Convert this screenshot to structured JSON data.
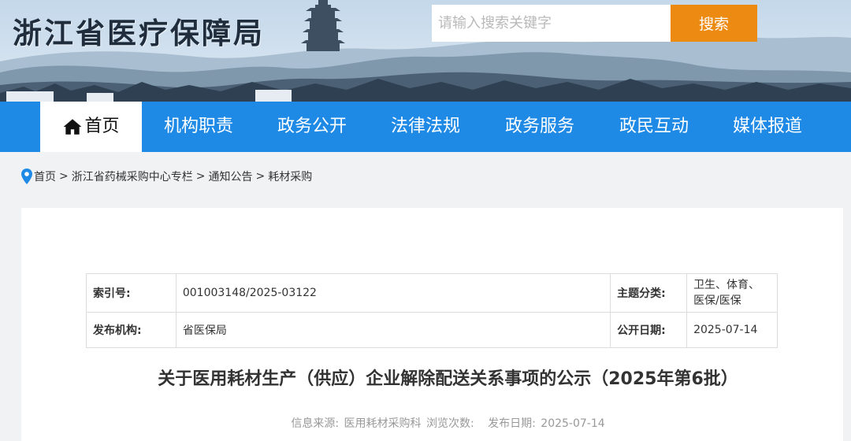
{
  "header": {
    "site_title": "浙江省医疗保障局",
    "search_placeholder": "请输入搜索关键字",
    "search_button": "搜索"
  },
  "nav": {
    "items": [
      {
        "label": "首页",
        "active": true
      },
      {
        "label": "机构职责"
      },
      {
        "label": "政务公开"
      },
      {
        "label": "法律法规"
      },
      {
        "label": "政务服务"
      },
      {
        "label": "政民互动"
      },
      {
        "label": "媒体报道"
      }
    ]
  },
  "breadcrumb": {
    "items": [
      "首页",
      "浙江省药械采购中心专栏",
      "通知公告",
      "耗材采购"
    ],
    "separator": ">"
  },
  "meta": {
    "index_label": "索引号:",
    "index_value": "001003148/2025-03122",
    "topic_label": "主题分类:",
    "topic_value": "卫生、体育、医保/医保",
    "org_label": "发布机构:",
    "org_value": "省医保局",
    "date_label": "公开日期:",
    "date_value": "2025-07-14"
  },
  "article": {
    "title": "关于医用耗材生产（供应）企业解除配送关系事项的公示（2025年第6批）",
    "source_label": "信息来源:",
    "source_value": "医用耗材采购科",
    "views_label": "浏览次数:",
    "publish_label": "发布日期:",
    "publish_value": "2025-07-14"
  },
  "colors": {
    "nav_bg": "#1e8ae6",
    "search_button_bg": "#ec8a12",
    "card_bg": "#ffffff",
    "page_bg": "#f1f2f4"
  },
  "icons": {
    "home": "home-icon",
    "location": "location-pin-icon"
  }
}
